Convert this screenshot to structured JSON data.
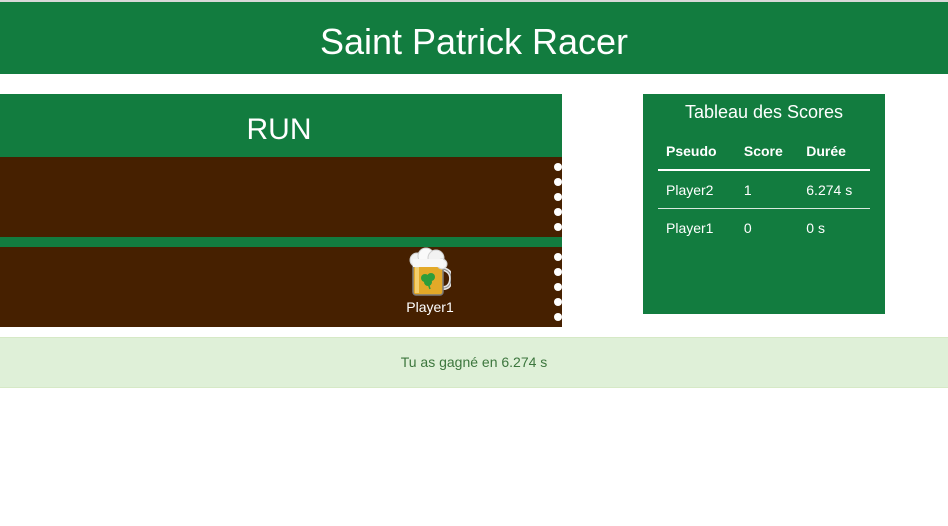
{
  "header": {
    "title": "Saint Patrick Racer"
  },
  "game": {
    "run_label": "RUN",
    "lanes": [
      {
        "player": null,
        "progress": null
      },
      {
        "player": "Player1",
        "progress": 0.73,
        "avatar_icon": "beer-mug-icon"
      }
    ]
  },
  "scoreboard": {
    "title": "Tableau des Scores",
    "columns": [
      "Pseudo",
      "Score",
      "Durée"
    ],
    "rows": [
      [
        "Player2",
        "1",
        "6.274 s"
      ],
      [
        "Player1",
        "0",
        "0 s"
      ]
    ]
  },
  "alert": {
    "message": "Tu as gagné en 6.274 s"
  },
  "colors": {
    "primary_green": "#127c3f",
    "track_brown": "#462000",
    "success_bg": "#dff0d8",
    "success_text": "#3c763d"
  }
}
